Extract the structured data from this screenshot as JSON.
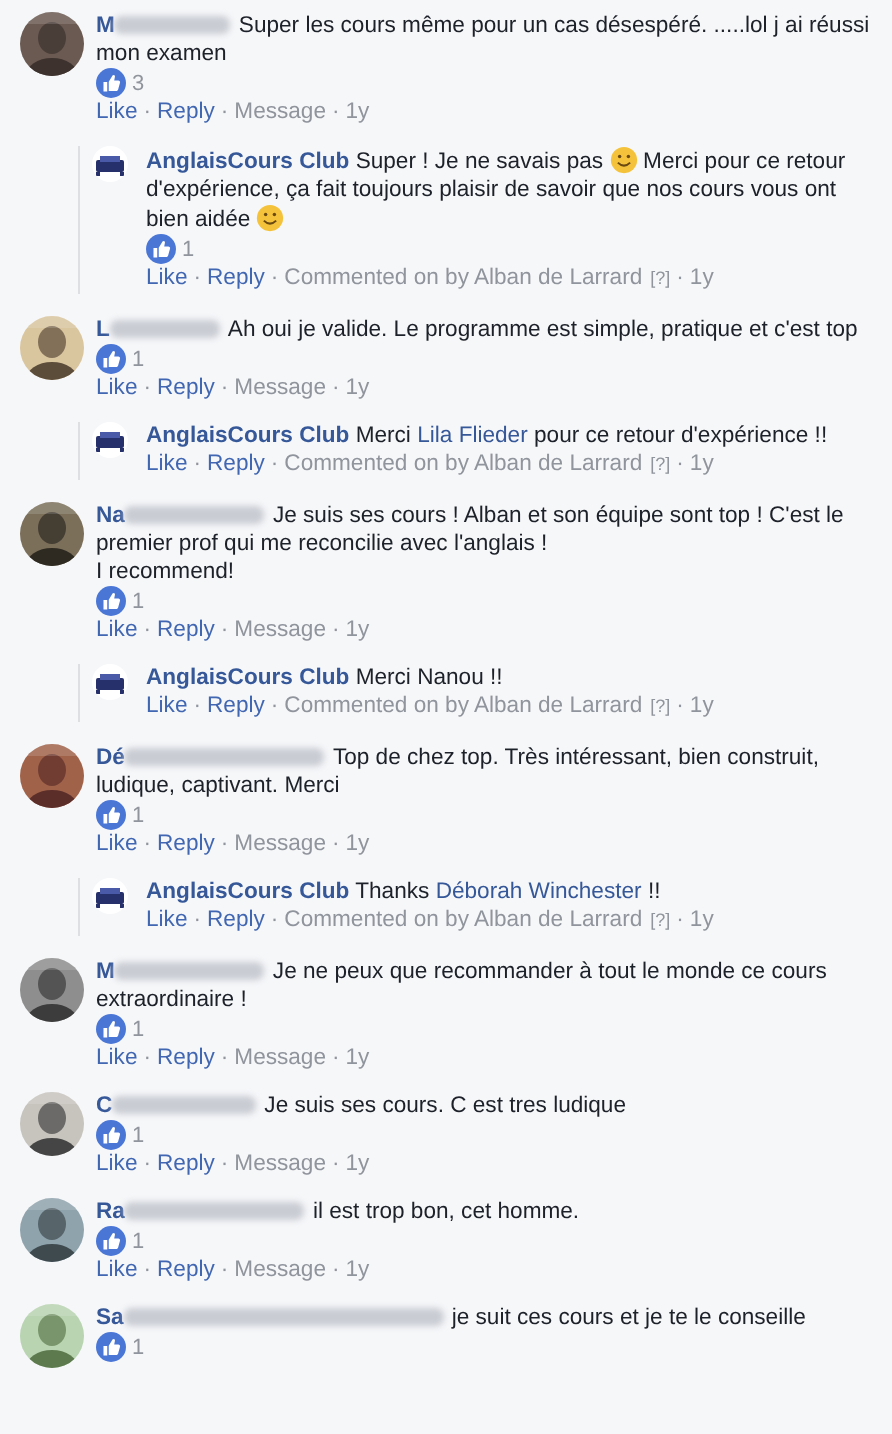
{
  "separator": "·",
  "comments": [
    {
      "author": "M",
      "text": [
        {
          "kind": "text",
          "text": "Super les cours même pour un cas désespéré. .....lol j ai réussi mon examen"
        }
      ],
      "likes": "3",
      "actions": [
        {
          "kind": "link",
          "text": "Like"
        },
        {
          "kind": "link",
          "text": "Reply"
        },
        {
          "kind": "plain",
          "text": "Message"
        },
        {
          "kind": "plain",
          "text": "1y"
        }
      ],
      "replies": [
        {
          "author": "AnglaisCours Club",
          "text": [
            {
              "kind": "text",
              "text": "Super ! Je ne savais pas"
            },
            {
              "kind": "emoji"
            },
            {
              "kind": "text",
              "text": "Merci pour ce retour d'expérience, ça fait toujours plaisir de savoir que nos cours vous ont bien aidée"
            },
            {
              "kind": "emoji"
            }
          ],
          "likes": "1",
          "actions": [
            {
              "kind": "link",
              "text": "Like"
            },
            {
              "kind": "link",
              "text": "Reply"
            },
            {
              "kind": "plain",
              "text": "Commented on by Alban de Larrard"
            },
            {
              "kind": "help",
              "text": "[?]"
            },
            {
              "kind": "plain",
              "text": "1y"
            }
          ]
        }
      ]
    },
    {
      "author": "L",
      "text": [
        {
          "kind": "text",
          "text": "Ah oui je valide. Le programme est simple, pratique et c'est top"
        }
      ],
      "likes": "1",
      "actions": [
        {
          "kind": "link",
          "text": "Like"
        },
        {
          "kind": "link",
          "text": "Reply"
        },
        {
          "kind": "plain",
          "text": "Message"
        },
        {
          "kind": "plain",
          "text": "1y"
        }
      ],
      "replies": [
        {
          "author": "AnglaisCours Club",
          "text": [
            {
              "kind": "text",
              "text": "Merci"
            },
            {
              "kind": "mention",
              "text": "Lila Flieder"
            },
            {
              "kind": "text",
              "text": "pour ce retour d'expérience !!"
            }
          ],
          "actions": [
            {
              "kind": "link",
              "text": "Like"
            },
            {
              "kind": "link",
              "text": "Reply"
            },
            {
              "kind": "plain",
              "text": "Commented on by Alban de Larrard"
            },
            {
              "kind": "help",
              "text": "[?]"
            },
            {
              "kind": "plain",
              "text": "1y"
            }
          ]
        }
      ]
    },
    {
      "author": "Na",
      "text": [
        {
          "kind": "text",
          "text": "Je suis ses cours ! Alban et son équipe sont top ! C'est le premier prof qui me reconcilie avec l'anglais !"
        },
        {
          "kind": "break"
        },
        {
          "kind": "text",
          "text": "I recommend!"
        }
      ],
      "likes": "1",
      "actions": [
        {
          "kind": "link",
          "text": "Like"
        },
        {
          "kind": "link",
          "text": "Reply"
        },
        {
          "kind": "plain",
          "text": "Message"
        },
        {
          "kind": "plain",
          "text": "1y"
        }
      ],
      "replies": [
        {
          "author": "AnglaisCours Club",
          "text": [
            {
              "kind": "text",
              "text": "Merci Nanou !!"
            }
          ],
          "actions": [
            {
              "kind": "link",
              "text": "Like"
            },
            {
              "kind": "link",
              "text": "Reply"
            },
            {
              "kind": "plain",
              "text": "Commented on by Alban de Larrard"
            },
            {
              "kind": "help",
              "text": "[?]"
            },
            {
              "kind": "plain",
              "text": "1y"
            }
          ]
        }
      ]
    },
    {
      "author": "Dé",
      "text": [
        {
          "kind": "text",
          "text": "Top de chez top. Très intéressant, bien construit, ludique, captivant. Merci"
        }
      ],
      "likes": "1",
      "actions": [
        {
          "kind": "link",
          "text": "Like"
        },
        {
          "kind": "link",
          "text": "Reply"
        },
        {
          "kind": "plain",
          "text": "Message"
        },
        {
          "kind": "plain",
          "text": "1y"
        }
      ],
      "replies": [
        {
          "author": "AnglaisCours Club",
          "text": [
            {
              "kind": "text",
              "text": "Thanks"
            },
            {
              "kind": "mention",
              "text": "Déborah Winchester"
            },
            {
              "kind": "text",
              "text": "!!"
            }
          ],
          "actions": [
            {
              "kind": "link",
              "text": "Like"
            },
            {
              "kind": "link",
              "text": "Reply"
            },
            {
              "kind": "plain",
              "text": "Commented on by Alban de Larrard"
            },
            {
              "kind": "help",
              "text": "[?]"
            },
            {
              "kind": "plain",
              "text": "1y"
            }
          ]
        }
      ]
    },
    {
      "author": "M",
      "text": [
        {
          "kind": "text",
          "text": "Je ne peux que recommander à tout le monde ce cours extraordinaire !"
        }
      ],
      "likes": "1",
      "actions": [
        {
          "kind": "link",
          "text": "Like"
        },
        {
          "kind": "link",
          "text": "Reply"
        },
        {
          "kind": "plain",
          "text": "Message"
        },
        {
          "kind": "plain",
          "text": "1y"
        }
      ]
    },
    {
      "author": "C",
      "text": [
        {
          "kind": "text",
          "text": "Je suis ses cours. C est tres ludique"
        }
      ],
      "likes": "1",
      "actions": [
        {
          "kind": "link",
          "text": "Like"
        },
        {
          "kind": "link",
          "text": "Reply"
        },
        {
          "kind": "plain",
          "text": "Message"
        },
        {
          "kind": "plain",
          "text": "1y"
        }
      ]
    },
    {
      "author": "Ra",
      "text": [
        {
          "kind": "text",
          "text": "il est trop bon, cet homme."
        }
      ],
      "likes": "1",
      "actions": [
        {
          "kind": "link",
          "text": "Like"
        },
        {
          "kind": "link",
          "text": "Reply"
        },
        {
          "kind": "plain",
          "text": "Message"
        },
        {
          "kind": "plain",
          "text": "1y"
        }
      ]
    },
    {
      "author": "Sa",
      "text": [
        {
          "kind": "text",
          "text": "je suit ces cours et je te le conseille"
        }
      ],
      "likes": "1"
    }
  ]
}
